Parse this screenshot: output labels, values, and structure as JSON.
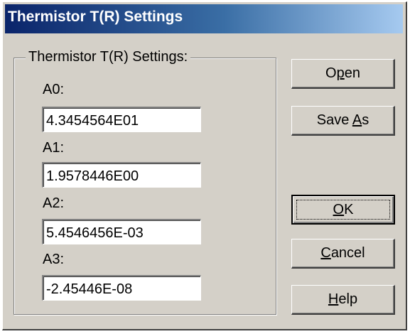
{
  "window": {
    "title": "Thermistor T(R) Settings"
  },
  "group": {
    "legend": "Thermistor T(R) Settings:",
    "fields": [
      {
        "label": "A0:",
        "value": "4.3454564E01"
      },
      {
        "label": "A1:",
        "value": "1.9578446E00"
      },
      {
        "label": "A2:",
        "value": "5.4546456E-03"
      },
      {
        "label": "A3:",
        "value": "-2.45446E-08"
      }
    ]
  },
  "buttons": {
    "open": {
      "pre": "O",
      "mnemonic": "p",
      "post": "en"
    },
    "save_as": {
      "pre": "Save ",
      "mnemonic": "A",
      "post": "s"
    },
    "ok": {
      "pre": "",
      "mnemonic": "O",
      "post": "K"
    },
    "cancel": {
      "pre": "",
      "mnemonic": "C",
      "post": "ancel"
    },
    "help": {
      "pre": "",
      "mnemonic": "H",
      "post": "elp"
    }
  }
}
